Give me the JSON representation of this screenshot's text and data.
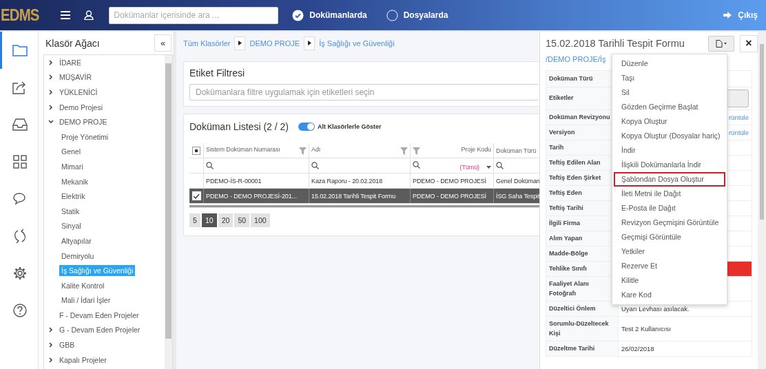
{
  "header": {
    "logo": "EDMS",
    "search": {
      "placeholder": "Dokümanlar içerisinde ara ..."
    },
    "scopes": [
      {
        "label": "Dokümanlarda",
        "selected": true
      },
      {
        "label": "Dosyalarda",
        "selected": false
      }
    ],
    "logout": "Çıkış"
  },
  "rail": [
    {
      "kind": "folder",
      "selected": true
    },
    {
      "kind": "share",
      "selected": false
    },
    {
      "kind": "inbox",
      "selected": false
    },
    {
      "kind": "grid",
      "selected": false
    },
    {
      "kind": "chat",
      "selected": false
    },
    {
      "kind": "sync",
      "selected": false
    },
    {
      "kind": "settings",
      "selected": false
    },
    {
      "kind": "help",
      "selected": false
    }
  ],
  "tree": {
    "title": "Klasör Ağacı",
    "collapse": "«",
    "items": [
      {
        "label": "İDARE",
        "expanded": false,
        "selected": false
      },
      {
        "label": "MÜŞAVİR",
        "expanded": false,
        "selected": false
      },
      {
        "label": "YÜKLENİCİ",
        "expanded": false,
        "selected": false
      },
      {
        "label": "Demo Projesi",
        "expanded": false,
        "selected": false
      },
      {
        "label": "DEMO PROJE",
        "expanded": true,
        "selected": false,
        "children": [
          {
            "label": "Proje Yönetimi",
            "selected": false
          },
          {
            "label": "Genel",
            "selected": false
          },
          {
            "label": "Mimari",
            "selected": false
          },
          {
            "label": "Mekanik",
            "selected": false
          },
          {
            "label": "Elektrik",
            "selected": false
          },
          {
            "label": "Statik",
            "selected": false
          },
          {
            "label": "Sinyal",
            "selected": false
          },
          {
            "label": "Altyapılar",
            "selected": false
          },
          {
            "label": "Demiryolu",
            "selected": false
          },
          {
            "label": "İş Sağlığı ve Güvenliği",
            "selected": true
          },
          {
            "label": "Kalite Kontrol",
            "selected": false
          },
          {
            "label": "Mali / İdari İşler",
            "selected": false
          }
        ]
      },
      {
        "label": "F - Devam Eden Projeler",
        "selected": false
      },
      {
        "label": "G - Devam Eden Projeler",
        "expanded": false,
        "selected": false
      },
      {
        "label": "GBB",
        "expanded": false,
        "selected": false
      },
      {
        "label": "Kapalı Projeler",
        "expanded": false,
        "selected": false
      }
    ]
  },
  "breadcrumb": [
    "Tüm Klasörler",
    "DEMO PROJE",
    "İş Sağlığı ve Güvenliği"
  ],
  "tag_filter": {
    "title": "Etiket Filtresi",
    "placeholder": "Dokümanlara filtre uygulamak için etiketleri seçin"
  },
  "doc_list": {
    "title": "Doküman Listesi (2 / 2)",
    "toggle": {
      "label": "Alt Klasörlerle Göster",
      "on": true
    },
    "select_all": {
      "indeterminate": true
    },
    "columns": [
      {
        "label": "Sistem Doküman Numarası",
        "kind": "filter_right"
      },
      {
        "label": "Adı",
        "kind": "filter_right"
      },
      {
        "label": "Proje Kodu",
        "kind": "filter_left",
        "filter_value": "(Tümü)"
      },
      {
        "label": "Doküman Türü",
        "kind": "plain"
      }
    ],
    "rows": [
      {
        "selected": false,
        "cells": [
          "PDEMO-İS-R-00001",
          "Kaza Raporu - 20.02.2018",
          "PDEMO - DEMO PROJESİ",
          "Genel Doküman"
        ]
      },
      {
        "selected": true,
        "cells": [
          "PDEMO - DEMO PROJESİ-201...",
          "15.02.2018 Tarihli Tespit Formu",
          "PDEMO - DEMO PROJESİ",
          "İSG Saha Tespit"
        ]
      }
    ],
    "page_sizes": [
      {
        "label": "5",
        "selected": false
      },
      {
        "label": "10",
        "selected": true
      },
      {
        "label": "20",
        "selected": false
      },
      {
        "label": "50",
        "selected": false
      },
      {
        "label": "100",
        "selected": false
      }
    ]
  },
  "detail": {
    "title": "15.02.2018 Tarihli Tespit Formu",
    "path": "/DEMO PROJE/İş",
    "close": "×",
    "rows": [
      {
        "label": "Doküman Türü",
        "kind": "text"
      },
      {
        "label": "Etiketler",
        "kind": "tags"
      },
      {
        "label": "Doküman Revizyonu",
        "kind": "link",
        "value": "rüntüle"
      },
      {
        "label": "Versiyon",
        "kind": "link",
        "value": "rüntüle"
      },
      {
        "label": "Tarih",
        "kind": "text"
      },
      {
        "label": "Teftiş Edilen Alan",
        "kind": "text"
      },
      {
        "label": "Teftiş Eden Şirket",
        "kind": "text"
      },
      {
        "label": "Teftiş Eden",
        "kind": "text"
      },
      {
        "label": "Teftiş Tarihi",
        "kind": "text"
      },
      {
        "label": "İlgili Firma",
        "kind": "text"
      },
      {
        "label": "Alım Yapan",
        "kind": "text"
      },
      {
        "label": "Madde-Bölge",
        "kind": "text"
      },
      {
        "label": "Tehlike Sınıfı",
        "kind": "color",
        "color": "#e8302a"
      },
      {
        "label": "Faaliyet Alanı Fotoğrafı",
        "kind": "text"
      },
      {
        "label": "Düzeltici Önlem",
        "kind": "text",
        "value": "Uyarı Levhası asılacak."
      },
      {
        "label": "Sorumlu-Düzeltecek Kişi",
        "kind": "text",
        "value": "Test 2 Kullanıcısı"
      },
      {
        "label": "Düzeltme Tarihi",
        "kind": "text",
        "value": "26/02/2018"
      }
    ],
    "menu": [
      {
        "label": "Düzenle",
        "selected": false
      },
      {
        "label": "Taşı",
        "selected": false
      },
      {
        "label": "Sil",
        "selected": false
      },
      {
        "label": "Gözden Geçirme Başlat",
        "selected": false
      },
      {
        "label": "Kopya Oluştur",
        "selected": false
      },
      {
        "label": "Kopya Oluştur (Dosyalar hariç)",
        "selected": false
      },
      {
        "label": "İndir",
        "selected": false
      },
      {
        "label": "İlişkili Dokümanlarla İndir",
        "selected": false
      },
      {
        "label": "Şablondan Dosya Oluştur",
        "selected": true
      },
      {
        "label": "İleti Metni ile Dağıt",
        "selected": false
      },
      {
        "label": "E-Posta ile Dağıt",
        "selected": false
      },
      {
        "label": "Revizyon Geçmişini Görüntüle",
        "selected": false
      },
      {
        "label": "Geçmişi Görüntüle",
        "selected": false
      },
      {
        "label": "Yetkiler",
        "selected": false
      },
      {
        "label": "Rezerve Et",
        "selected": false
      },
      {
        "label": "Kilitle",
        "selected": false
      },
      {
        "label": "Kare Kod",
        "selected": false
      }
    ]
  }
}
